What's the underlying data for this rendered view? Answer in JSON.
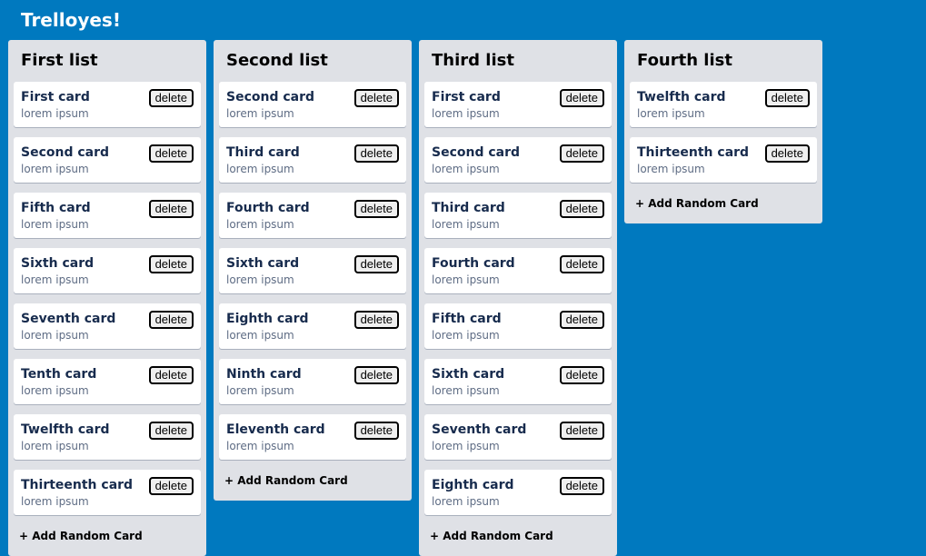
{
  "app": {
    "title": "Trelloyes!"
  },
  "lists": [
    {
      "title": "First list",
      "cards": [
        {
          "title": "First card",
          "content": "lorem ipsum",
          "delete_label": "delete"
        },
        {
          "title": "Second card",
          "content": "lorem ipsum",
          "delete_label": "delete"
        },
        {
          "title": "Fifth card",
          "content": "lorem ipsum",
          "delete_label": "delete"
        },
        {
          "title": "Sixth card",
          "content": "lorem ipsum",
          "delete_label": "delete"
        },
        {
          "title": "Seventh card",
          "content": "lorem ipsum",
          "delete_label": "delete"
        },
        {
          "title": "Tenth card",
          "content": "lorem ipsum",
          "delete_label": "delete"
        },
        {
          "title": "Twelfth card",
          "content": "lorem ipsum",
          "delete_label": "delete"
        },
        {
          "title": "Thirteenth card",
          "content": "lorem ipsum",
          "delete_label": "delete"
        }
      ],
      "add_label": "+ Add Random Card"
    },
    {
      "title": "Second list",
      "cards": [
        {
          "title": "Second card",
          "content": "lorem ipsum",
          "delete_label": "delete"
        },
        {
          "title": "Third card",
          "content": "lorem ipsum",
          "delete_label": "delete"
        },
        {
          "title": "Fourth card",
          "content": "lorem ipsum",
          "delete_label": "delete"
        },
        {
          "title": "Sixth card",
          "content": "lorem ipsum",
          "delete_label": "delete"
        },
        {
          "title": "Eighth card",
          "content": "lorem ipsum",
          "delete_label": "delete"
        },
        {
          "title": "Ninth card",
          "content": "lorem ipsum",
          "delete_label": "delete"
        },
        {
          "title": "Eleventh card",
          "content": "lorem ipsum",
          "delete_label": "delete"
        }
      ],
      "add_label": "+ Add Random Card"
    },
    {
      "title": "Third list",
      "cards": [
        {
          "title": "First card",
          "content": "lorem ipsum",
          "delete_label": "delete"
        },
        {
          "title": "Second card",
          "content": "lorem ipsum",
          "delete_label": "delete"
        },
        {
          "title": "Third card",
          "content": "lorem ipsum",
          "delete_label": "delete"
        },
        {
          "title": "Fourth card",
          "content": "lorem ipsum",
          "delete_label": "delete"
        },
        {
          "title": "Fifth card",
          "content": "lorem ipsum",
          "delete_label": "delete"
        },
        {
          "title": "Sixth card",
          "content": "lorem ipsum",
          "delete_label": "delete"
        },
        {
          "title": "Seventh card",
          "content": "lorem ipsum",
          "delete_label": "delete"
        },
        {
          "title": "Eighth card",
          "content": "lorem ipsum",
          "delete_label": "delete"
        }
      ],
      "add_label": "+ Add Random Card"
    },
    {
      "title": "Fourth list",
      "cards": [
        {
          "title": "Twelfth card",
          "content": "lorem ipsum",
          "delete_label": "delete"
        },
        {
          "title": "Thirteenth card",
          "content": "lorem ipsum",
          "delete_label": "delete"
        }
      ],
      "add_label": "+ Add Random Card"
    }
  ]
}
